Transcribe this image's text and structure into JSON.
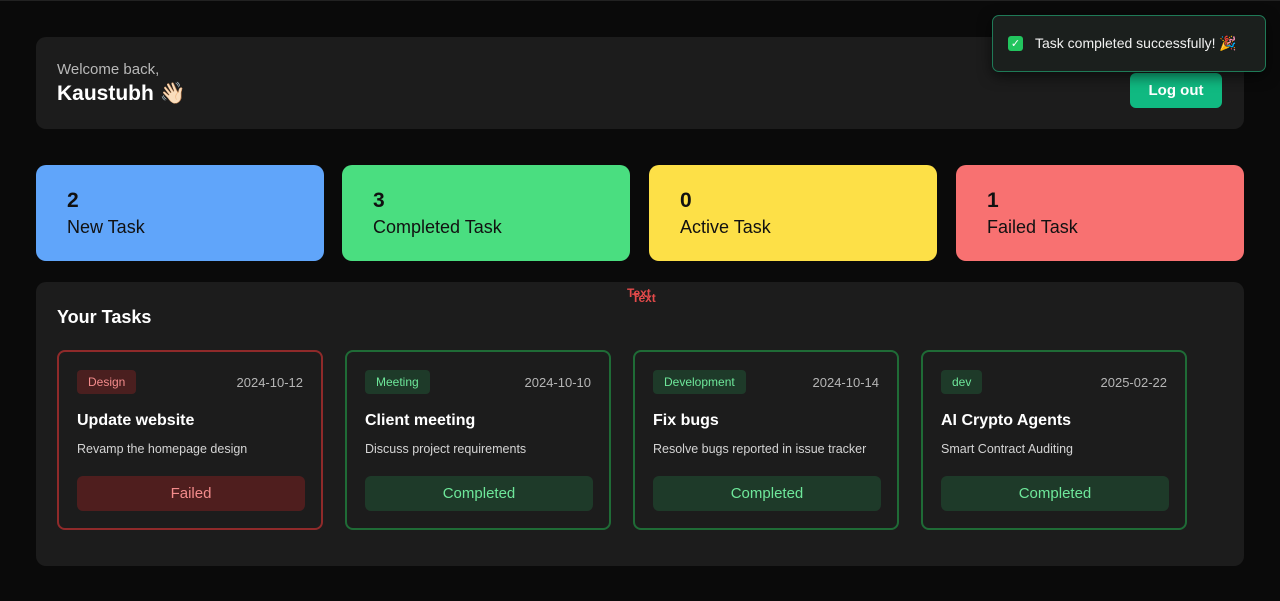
{
  "header": {
    "welcome": "Welcome back,",
    "username": "Kaustubh 👋🏻",
    "logout_label": "Log out"
  },
  "toast": {
    "icon": "✓",
    "message": "Task completed successfully! 🎉"
  },
  "stats": [
    {
      "count": "2",
      "label": "New Task",
      "color": "#60a5fa"
    },
    {
      "count": "3",
      "label": "Completed Task",
      "color": "#4ade80"
    },
    {
      "count": "0",
      "label": "Active Task",
      "color": "#fde047"
    },
    {
      "count": "1",
      "label": "Failed Task",
      "color": "#f87171"
    }
  ],
  "tasks_panel": {
    "title": "Your Tasks",
    "stray_text_1": "Text",
    "stray_text_2": "Text"
  },
  "tasks": [
    {
      "tag": "Design",
      "date": "2024-10-12",
      "title": "Update website",
      "description": "Revamp the homepage design",
      "status": "Failed"
    },
    {
      "tag": "Meeting",
      "date": "2024-10-10",
      "title": "Client meeting",
      "description": "Discuss project requirements",
      "status": "Completed"
    },
    {
      "tag": "Development",
      "date": "2024-10-14",
      "title": "Fix bugs",
      "description": "Resolve bugs reported in issue tracker",
      "status": "Completed"
    },
    {
      "tag": "dev",
      "date": "2025-02-22",
      "title": "AI Crypto Agents",
      "description": "Smart Contract Auditing",
      "status": "Completed"
    }
  ],
  "colors": {
    "accent": "#10b981",
    "background": "#0a0a0a",
    "panel": "#1c1c1c",
    "completed": "#6ee79a",
    "failed": "#f38b8b"
  }
}
